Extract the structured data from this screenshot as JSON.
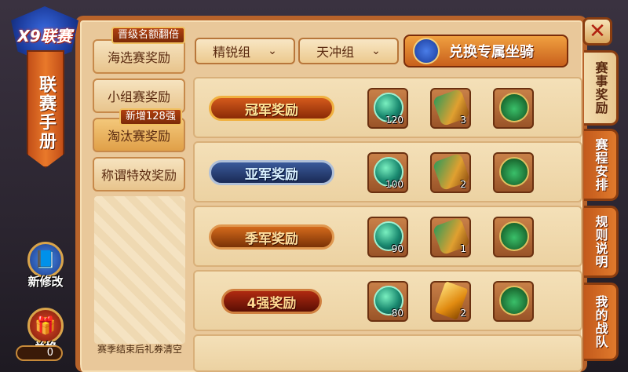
{
  "close_label": "✕",
  "manual": {
    "logo_text": "X9联赛",
    "title": "联赛手册",
    "buttons": [
      {
        "label": "新修改",
        "icon": "book-icon"
      },
      {
        "label": "兑换",
        "icon": "gift-icon"
      }
    ],
    "exchange_count": "0"
  },
  "right_tabs": [
    {
      "label": "赛事奖励",
      "active": true
    },
    {
      "label": "赛程安排",
      "active": false
    },
    {
      "label": "规则说明",
      "active": false
    },
    {
      "label": "我的战队",
      "active": false
    }
  ],
  "categories": [
    {
      "label": "海选赛奖励",
      "tag": "晋级名额翻倍"
    },
    {
      "label": "小组赛奖励",
      "tag": ""
    },
    {
      "label": "淘汰赛奖励",
      "tag": "新增128强"
    },
    {
      "label": "称谓特效奖励",
      "tag": ""
    }
  ],
  "category_note": "赛季结束后礼券清空",
  "filters": {
    "group_1": "精锐组",
    "group_2": "天冲组",
    "chevron": "⌄"
  },
  "exchange_button": "兑换专属坐骑",
  "rewards": [
    {
      "rank": "冠军奖励",
      "items": [
        {
          "icon": "orb-icon",
          "count": "120"
        },
        {
          "icon": "scroll-icon",
          "count": "3"
        },
        {
          "icon": "bag-icon",
          "count": ""
        }
      ]
    },
    {
      "rank": "亚军奖励",
      "items": [
        {
          "icon": "orb-icon",
          "count": "100"
        },
        {
          "icon": "scroll-icon",
          "count": "2"
        },
        {
          "icon": "bag-icon",
          "count": ""
        }
      ]
    },
    {
      "rank": "季军奖励",
      "items": [
        {
          "icon": "orb-icon",
          "count": "90"
        },
        {
          "icon": "scroll-icon",
          "count": "1"
        },
        {
          "icon": "bag-icon",
          "count": ""
        }
      ]
    },
    {
      "rank": "4强奖励",
      "items": [
        {
          "icon": "orb-icon",
          "count": "80"
        },
        {
          "icon": "gem-icon",
          "count": "2"
        },
        {
          "icon": "bag-icon",
          "count": ""
        }
      ]
    }
  ]
}
